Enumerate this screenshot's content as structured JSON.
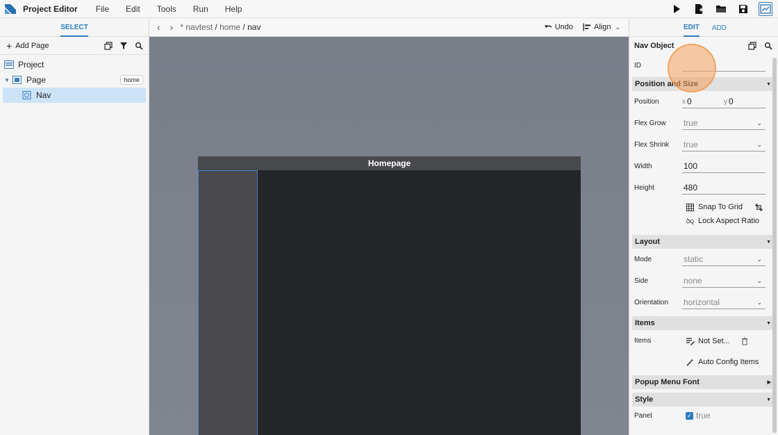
{
  "menubar": {
    "app_title": "Project Editor",
    "menus": [
      "File",
      "Edit",
      "Tools",
      "Run",
      "Help"
    ],
    "icons": [
      "play-icon",
      "new-file-icon",
      "open-folder-icon",
      "save-icon",
      "preview-icon"
    ]
  },
  "left": {
    "tab_select": "SELECT",
    "add_page": "Add Page",
    "tree": {
      "project": "Project",
      "page": "Page",
      "page_badge": "home",
      "nav": "Nav"
    }
  },
  "center": {
    "breadcrumb_prefix": "* navtest",
    "breadcrumb_sep1": " / ",
    "breadcrumb_home": "home",
    "breadcrumb_sep2": " / ",
    "breadcrumb_current": "nav",
    "undo": "Undo",
    "align": "Align",
    "homepage_title": "Homepage"
  },
  "right": {
    "tab_edit": "EDIT",
    "tab_add": "ADD",
    "header_title": "Nav Object",
    "id_label": "ID",
    "id_value": "",
    "sections": {
      "position_size": "Position and Size",
      "layout": "Layout",
      "items": "Items",
      "popup_menu_font": "Popup Menu Font",
      "style": "Style"
    },
    "position_label": "Position",
    "x_prefix": "x",
    "x_value": "0",
    "y_prefix": "y",
    "y_value": "0",
    "flex_grow_label": "Flex Grow",
    "flex_grow_value": "true",
    "flex_shrink_label": "Flex Shrink",
    "flex_shrink_value": "true",
    "width_label": "Width",
    "width_value": "100",
    "height_label": "Height",
    "height_value": "480",
    "snap_to_grid": "Snap To Grid",
    "lock_aspect": "Lock Aspect Ratio",
    "mode_label": "Mode",
    "mode_value": "static",
    "side_label": "Side",
    "side_value": "none",
    "orientation_label": "Orientation",
    "orientation_value": "horizontal",
    "items_label": "Items",
    "items_value": "Not Set...",
    "auto_config": "Auto Config Items",
    "panel_label": "Panel",
    "panel_value": "true"
  }
}
